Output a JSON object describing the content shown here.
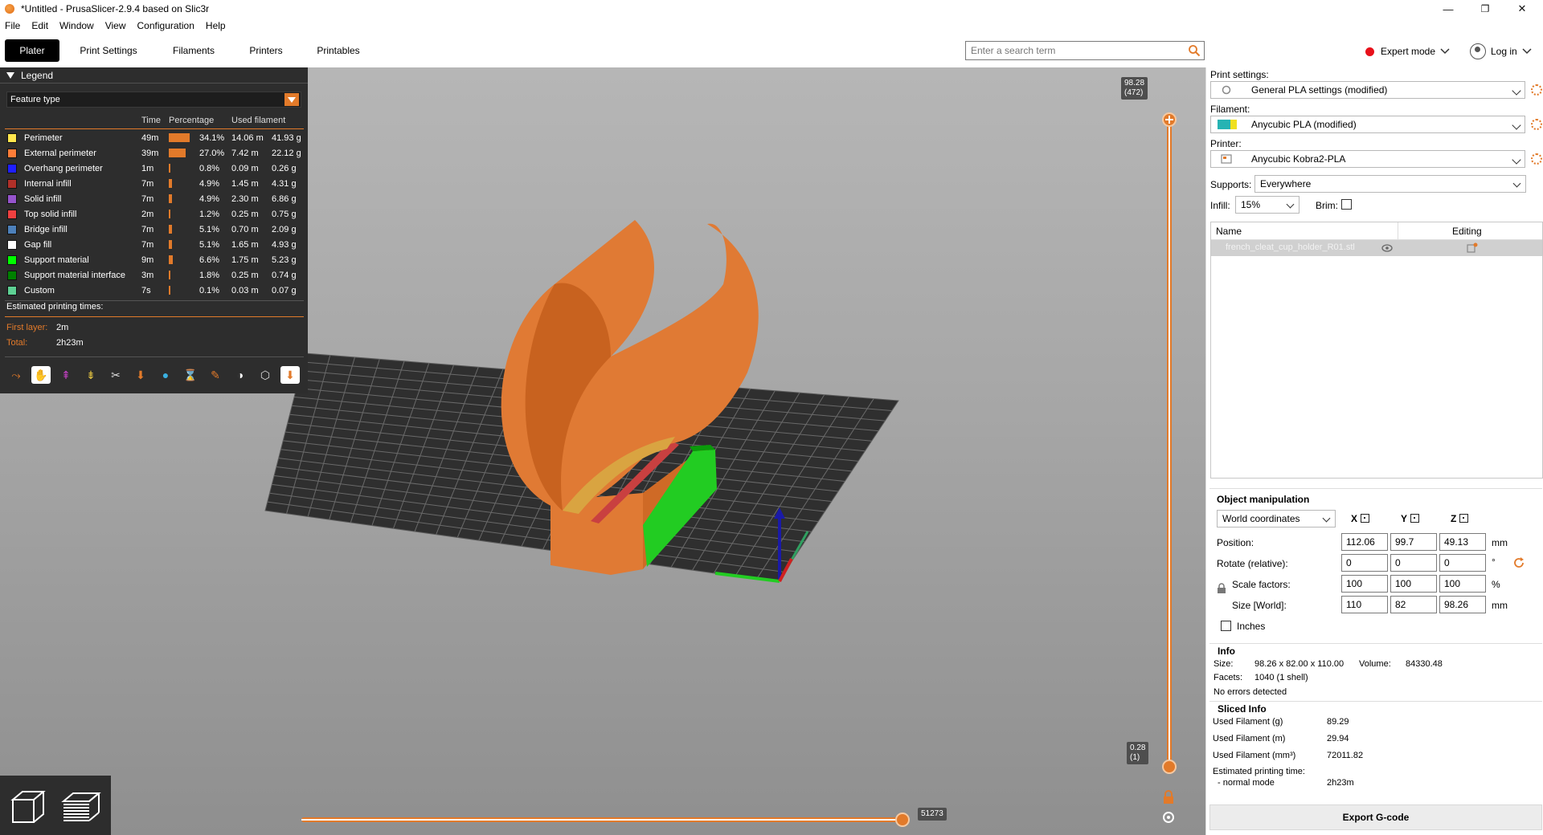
{
  "window": {
    "title": "*Untitled - PrusaSlicer-2.9.4 based on Slic3r",
    "minimize": "—",
    "restore": "❐",
    "close": "✕"
  },
  "menu": [
    "File",
    "Edit",
    "Window",
    "View",
    "Configuration",
    "Help"
  ],
  "tabs": [
    "Plater",
    "Print Settings",
    "Filaments",
    "Printers",
    "Printables"
  ],
  "search": {
    "placeholder": "Enter a search term"
  },
  "mode": {
    "label": "Expert mode",
    "color": "#e8101a"
  },
  "login": {
    "label": "Log in"
  },
  "legend": {
    "title": "Legend",
    "view_type": "Feature type",
    "columns": [
      "Time",
      "Percentage",
      "Used filament"
    ],
    "rows": [
      {
        "name": "Perimeter",
        "color": "#ffe64d",
        "time": "49m",
        "percent": "34.1%",
        "pct": 34.1,
        "length": "14.06 m",
        "weight": "41.93 g"
      },
      {
        "name": "External perimeter",
        "color": "#ff7d38",
        "time": "39m",
        "percent": "27.0%",
        "pct": 27.0,
        "length": "7.42 m",
        "weight": "22.12 g"
      },
      {
        "name": "Overhang perimeter",
        "color": "#1f1fff",
        "time": "1m",
        "percent": "0.8%",
        "pct": 0.8,
        "length": "0.09 m",
        "weight": "0.26 g"
      },
      {
        "name": "Internal infill",
        "color": "#b03029",
        "time": "7m",
        "percent": "4.9%",
        "pct": 4.9,
        "length": "1.45 m",
        "weight": "4.31 g"
      },
      {
        "name": "Solid infill",
        "color": "#9654cc",
        "time": "7m",
        "percent": "4.9%",
        "pct": 4.9,
        "length": "2.30 m",
        "weight": "6.86 g"
      },
      {
        "name": "Top solid infill",
        "color": "#f04040",
        "time": "2m",
        "percent": "1.2%",
        "pct": 1.2,
        "length": "0.25 m",
        "weight": "0.75 g"
      },
      {
        "name": "Bridge infill",
        "color": "#4d80ba",
        "time": "7m",
        "percent": "5.1%",
        "pct": 5.1,
        "length": "0.70 m",
        "weight": "2.09 g"
      },
      {
        "name": "Gap fill",
        "color": "#ffffff",
        "time": "7m",
        "percent": "5.1%",
        "pct": 5.1,
        "length": "1.65 m",
        "weight": "4.93 g"
      },
      {
        "name": "Support material",
        "color": "#00ff00",
        "time": "9m",
        "percent": "6.6%",
        "pct": 6.6,
        "length": "1.75 m",
        "weight": "5.23 g"
      },
      {
        "name": "Support material interface",
        "color": "#008000",
        "time": "3m",
        "percent": "1.8%",
        "pct": 1.8,
        "length": "0.25 m",
        "weight": "0.74 g"
      },
      {
        "name": "Custom",
        "color": "#5ed194",
        "time": "7s",
        "percent": "0.1%",
        "pct": 0.1,
        "length": "0.03 m",
        "weight": "0.07 g"
      }
    ],
    "estimated_title": "Estimated printing times:",
    "first_layer_label": "First layer:",
    "first_layer_value": "2m",
    "total_label": "Total:",
    "total_value": "2h23m"
  },
  "sliders": {
    "top_value": "98.28",
    "top_layer": "(472)",
    "bottom_value": "0.28",
    "bottom_layer": "(1)",
    "horizontal_value": "51273"
  },
  "sidebar": {
    "print_settings_label": "Print settings:",
    "print_settings_value": "General PLA settings (modified)",
    "filament_label": "Filament:",
    "filament_value": "Anycubic PLA (modified)",
    "printer_label": "Printer:",
    "printer_value": "Anycubic Kobra2-PLA",
    "supports_label": "Supports:",
    "supports_value": "Everywhere",
    "infill_label": "Infill:",
    "infill_value": "15%",
    "brim_label": "Brim:",
    "object_list": {
      "col_name": "Name",
      "col_editing": "Editing",
      "object_name": "french_cleat_cup_holder_R01.stl"
    },
    "object_manipulation": {
      "title": "Object manipulation",
      "coord_system": "World coordinates",
      "axes": [
        "X",
        "Y",
        "Z"
      ],
      "position_label": "Position:",
      "position": [
        "112.06",
        "99.7",
        "49.13"
      ],
      "position_unit": "mm",
      "rotate_label": "Rotate (relative):",
      "rotate": [
        "0",
        "0",
        "0"
      ],
      "rotate_unit": "°",
      "scale_label": "Scale factors:",
      "scale": [
        "100",
        "100",
        "100"
      ],
      "scale_unit": "%",
      "size_label": "Size [World]:",
      "size": [
        "110",
        "82",
        "98.26"
      ],
      "size_unit": "mm",
      "inches_label": "Inches"
    },
    "info": {
      "title": "Info",
      "size_label": "Size:",
      "size_value": "98.26 x 82.00 x 110.00",
      "volume_label": "Volume:",
      "volume_value": "84330.48",
      "facets_label": "Facets:",
      "facets_value": "1040 (1 shell)",
      "errors": "No errors detected"
    },
    "sliced_info": {
      "title": "Sliced Info",
      "rows": [
        {
          "label": "Used Filament (g)",
          "value": "89.29"
        },
        {
          "label": "Used Filament (m)",
          "value": "29.94"
        },
        {
          "label": "Used Filament (mm³)",
          "value": "72011.82"
        }
      ],
      "time_label": "Estimated printing time:",
      "mode_label": "- normal mode",
      "mode_value": "2h23m"
    },
    "export_label": "Export G-code"
  },
  "colors": {
    "accent": "#e27a2a",
    "legend_bg": "#2d2d2d"
  }
}
